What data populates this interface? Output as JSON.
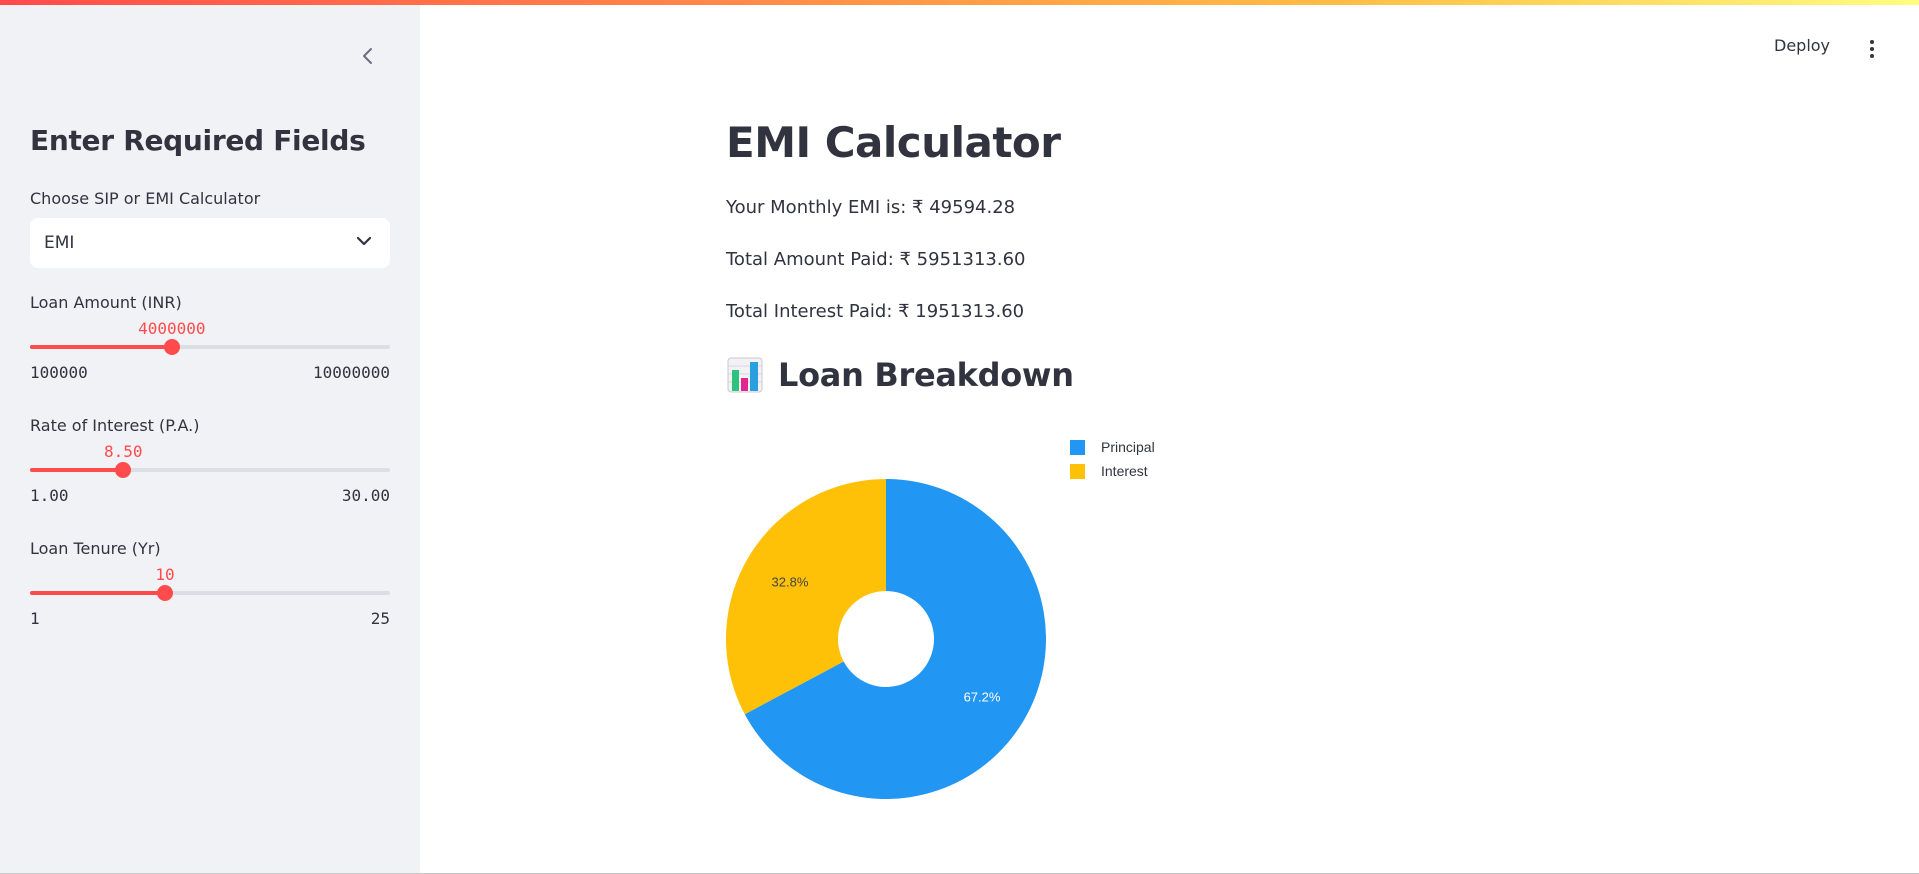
{
  "sidebar": {
    "title": "Enter Required Fields",
    "calc_select": {
      "label": "Choose SIP or EMI Calculator",
      "value": "EMI"
    },
    "loan_amount": {
      "label": "Loan Amount (INR)",
      "value": "4000000",
      "min": "100000",
      "max": "10000000",
      "fraction": 0.394
    },
    "interest_rate": {
      "label": "Rate of Interest (P.A.)",
      "value": "8.50",
      "min": "1.00",
      "max": "30.00",
      "fraction": 0.259
    },
    "tenure": {
      "label": "Loan Tenure (Yr)",
      "value": "10",
      "min": "1",
      "max": "25",
      "fraction": 0.375
    }
  },
  "header": {
    "deploy_label": "Deploy"
  },
  "main": {
    "title": "EMI Calculator",
    "monthly_emi": "Your Monthly EMI is: ₹ 49594.28",
    "total_amount": "Total Amount Paid: ₹ 5951313.60",
    "total_interest": "Total Interest Paid: ₹ 1951313.60",
    "section_title": "Loan Breakdown"
  },
  "colors": {
    "accent": "#ff4b4b",
    "principal": "#2196f3",
    "interest": "#ffc107"
  },
  "chart_data": {
    "type": "pie",
    "donut": true,
    "categories": [
      "Principal",
      "Interest"
    ],
    "values": [
      4000000,
      1951313.6
    ],
    "percent_labels": [
      "67.2%",
      "32.8%"
    ],
    "colors": [
      "#2196f3",
      "#ffc107"
    ],
    "legend_position": "top-right"
  }
}
